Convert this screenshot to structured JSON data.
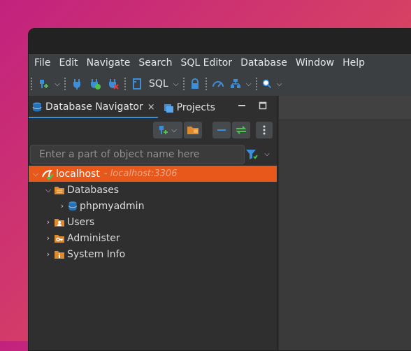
{
  "menu": [
    "File",
    "Edit",
    "Navigate",
    "Search",
    "SQL Editor",
    "Database",
    "Window",
    "Help"
  ],
  "toolbar": {
    "sql_label": "SQL"
  },
  "tabs": [
    {
      "label": "Database Navigator",
      "icon": "database-navigator-icon",
      "active": true,
      "close": "×"
    },
    {
      "label": "Projects",
      "icon": "projects-icon",
      "active": false
    }
  ],
  "search": {
    "placeholder": "Enter a part of object name here"
  },
  "tree": {
    "connection": {
      "label": "localhost",
      "detail": "- localhost:3306"
    },
    "databases": {
      "label": "Databases"
    },
    "phpmyadmin": {
      "label": "phpmyadmin"
    },
    "users": {
      "label": "Users"
    },
    "administer": {
      "label": "Administer"
    },
    "system_info": {
      "label": "System Info"
    }
  },
  "colors": {
    "selection": "#e8581a",
    "accent": "#3d8ed8",
    "folder": "#e08a2e"
  }
}
